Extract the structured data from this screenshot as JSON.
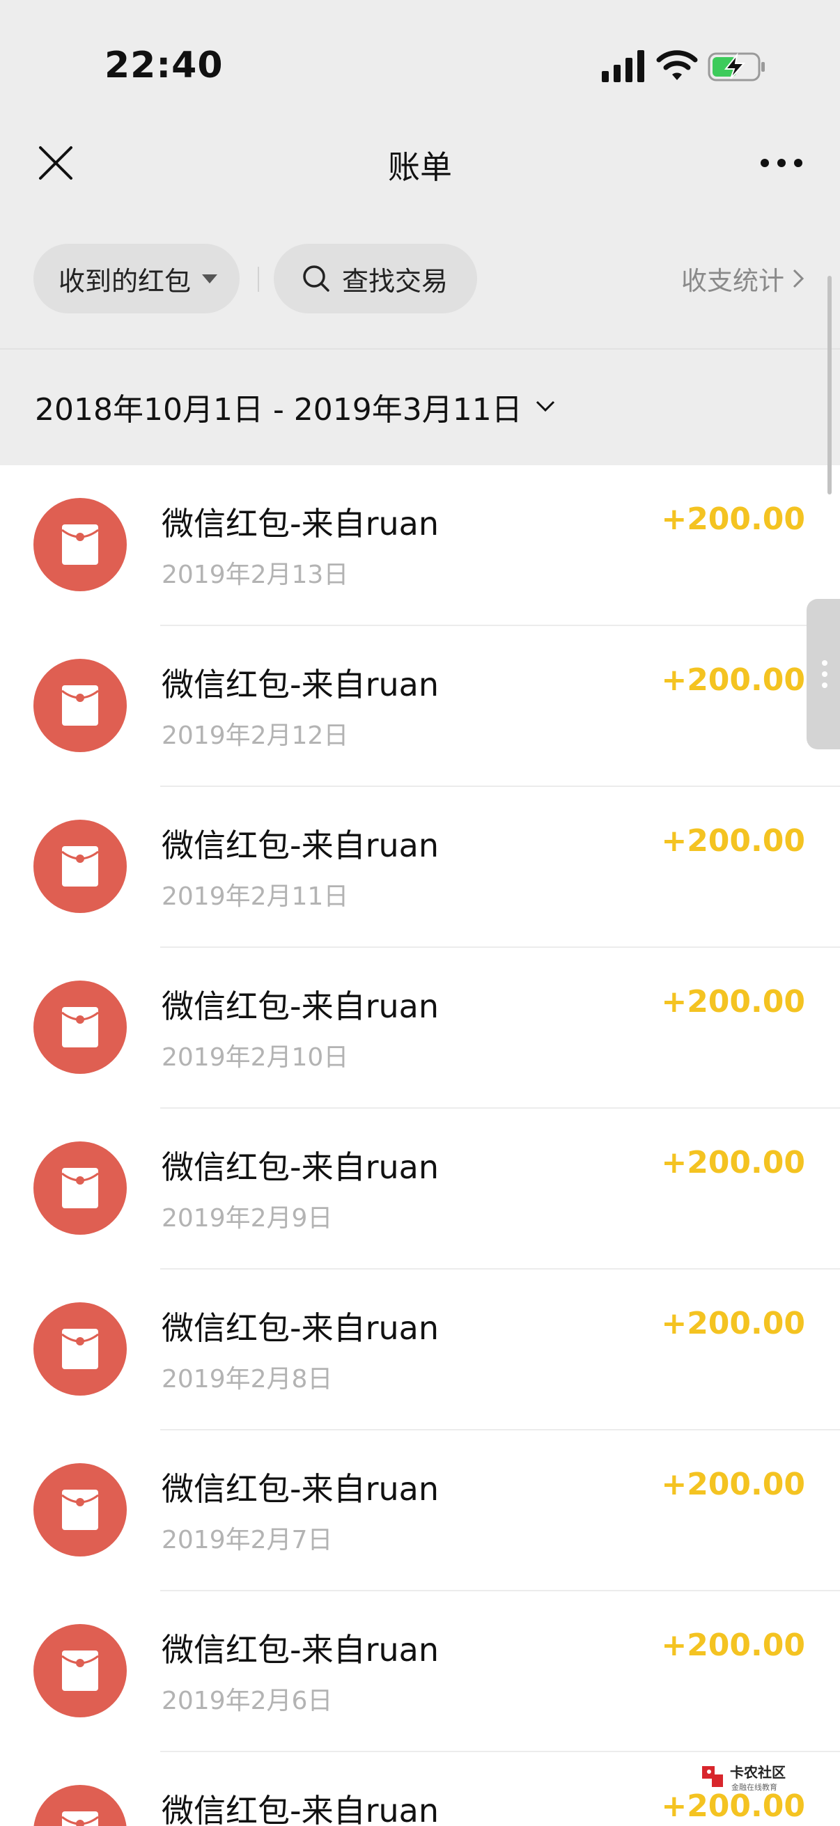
{
  "status": {
    "time": "22:40"
  },
  "nav": {
    "title": "账单"
  },
  "filters": {
    "received_label": "收到的红包",
    "search_label": "查找交易",
    "stats_label": "收支统计"
  },
  "date_range": "2018年10月1日 - 2019年3月11日",
  "transactions": [
    {
      "title": "微信红包-来自ruan",
      "date": "2019年2月13日",
      "amount": "+200.00"
    },
    {
      "title": "微信红包-来自ruan",
      "date": "2019年2月12日",
      "amount": "+200.00"
    },
    {
      "title": "微信红包-来自ruan",
      "date": "2019年2月11日",
      "amount": "+200.00"
    },
    {
      "title": "微信红包-来自ruan",
      "date": "2019年2月10日",
      "amount": "+200.00"
    },
    {
      "title": "微信红包-来自ruan",
      "date": "2019年2月9日",
      "amount": "+200.00"
    },
    {
      "title": "微信红包-来自ruan",
      "date": "2019年2月8日",
      "amount": "+200.00"
    },
    {
      "title": "微信红包-来自ruan",
      "date": "2019年2月7日",
      "amount": "+200.00"
    },
    {
      "title": "微信红包-来自ruan",
      "date": "2019年2月6日",
      "amount": "+200.00"
    },
    {
      "title": "微信红包-来自ruan",
      "date": "",
      "amount": "+200.00"
    }
  ],
  "watermark": {
    "text": "卡农社区",
    "subtext": "金融在线教育"
  },
  "colors": {
    "amount": "#f4c321",
    "red_packet": "#df5f52",
    "background": "#ededed"
  }
}
